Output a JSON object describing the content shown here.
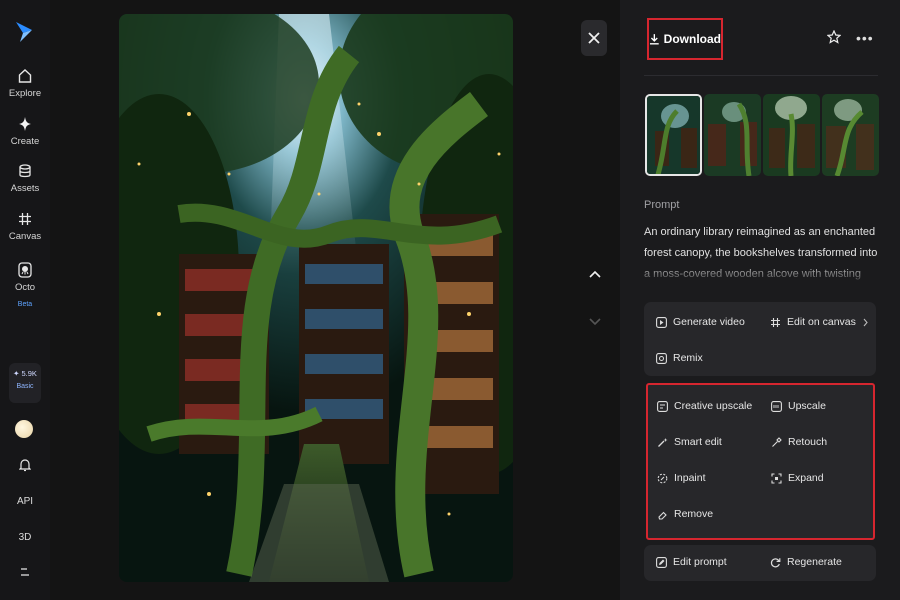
{
  "sidebar": {
    "items": [
      {
        "label": "Explore",
        "icon": "home-icon"
      },
      {
        "label": "Create",
        "icon": "sparkle-icon"
      },
      {
        "label": "Assets",
        "icon": "cylinder-icon"
      },
      {
        "label": "Canvas",
        "icon": "grid-hash-icon"
      },
      {
        "label": "Octo",
        "icon": "octo-icon",
        "badge": "Beta"
      }
    ],
    "credits": {
      "amount": "5.9K",
      "plan": "Basic"
    },
    "api_label": "API",
    "three_d_label": "3D"
  },
  "toolbar": {
    "download_label": "Download"
  },
  "prompt": {
    "heading": "Prompt",
    "text": "An ordinary library reimagined as an enchanted forest canopy, the bookshelves transformed into a moss-covered wooden alcove with twisting branch details, soft glowing"
  },
  "actions": {
    "generate_video": "Generate video",
    "edit_on_canvas": "Edit on canvas",
    "remix": "Remix",
    "creative_upscale": "Creative upscale",
    "upscale": "Upscale",
    "smart_edit": "Smart edit",
    "retouch": "Retouch",
    "inpaint": "Inpaint",
    "expand": "Expand",
    "remove": "Remove",
    "edit_prompt": "Edit prompt",
    "regenerate": "Regenerate"
  },
  "colors": {
    "highlight": "#d6262f",
    "accent": "#2b8cff"
  }
}
